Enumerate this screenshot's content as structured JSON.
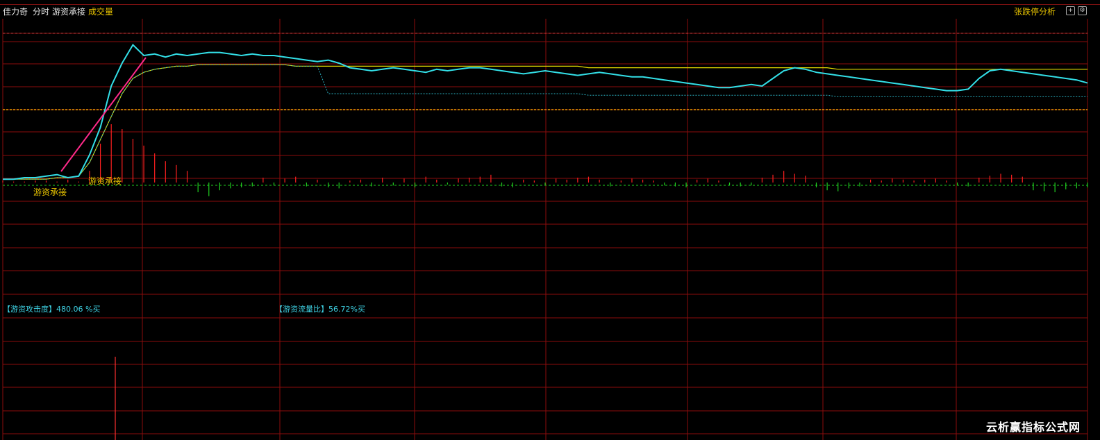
{
  "header": {
    "stock_name": "佳力奇",
    "period": "分时",
    "indicator": "游资承接",
    "volume_label": "成交量",
    "analysis_button": "张跌停分析"
  },
  "annotations": {
    "signal_1": "游资承接",
    "signal_2": "游资承接"
  },
  "indicators": {
    "attack_label": "【游资攻击度】",
    "attack_value": "480.06 %买",
    "flow_label": "【游资流量比】",
    "flow_value": "56.72%买"
  },
  "watermark": "云析赢指标公式网",
  "colors": {
    "grid": "#8b0d0d",
    "price": "#33e0e8",
    "price_up": "#ff2020",
    "avg": "#e8e000",
    "vol_up": "#ff2020",
    "vol_down": "#20d020",
    "label_yellow": "#e6c200",
    "label_cyan": "#3fd4e6"
  },
  "chart_data": {
    "type": "line",
    "note_series": "intraday price (relative, 0=top 100=bottom of price panel)",
    "price": [
      96,
      96,
      95,
      95,
      94,
      93,
      95,
      94,
      80,
      62,
      35,
      20,
      8,
      15,
      14,
      16,
      14,
      15,
      14,
      13,
      13,
      14,
      15,
      14,
      15,
      15,
      16,
      17,
      18,
      19,
      18,
      20,
      23,
      24,
      25,
      24,
      23,
      24,
      25,
      26,
      24,
      25,
      24,
      23,
      23,
      24,
      25,
      26,
      27,
      26,
      25,
      26,
      27,
      28,
      27,
      26,
      27,
      28,
      29,
      29,
      30,
      31,
      32,
      33,
      34,
      35,
      36,
      36,
      35,
      34,
      35,
      30,
      25,
      23,
      24,
      26,
      27,
      28,
      29,
      30,
      31,
      32,
      33,
      34,
      35,
      36,
      37,
      38,
      38,
      37,
      30,
      25,
      24,
      25,
      26,
      27,
      28,
      29,
      30,
      31,
      33
    ],
    "avg": [
      96,
      96,
      96,
      96,
      96,
      95,
      95,
      94,
      85,
      70,
      55,
      40,
      30,
      26,
      24,
      23,
      22,
      22,
      21,
      21,
      21,
      21,
      21,
      21,
      21,
      21,
      21,
      22,
      22,
      22,
      22,
      22,
      22,
      22,
      22,
      22,
      22,
      22,
      22,
      22,
      22,
      22,
      22,
      22,
      22,
      22,
      22,
      22,
      22,
      22,
      22,
      22,
      22,
      22,
      23,
      23,
      23,
      23,
      23,
      23,
      23,
      23,
      23,
      23,
      23,
      23,
      23,
      23,
      23,
      23,
      23,
      23,
      23,
      23,
      23,
      23,
      23,
      24,
      24,
      24,
      24,
      24,
      24,
      24,
      24,
      24,
      24,
      24,
      24,
      24,
      24,
      24,
      24,
      24,
      24,
      24,
      24,
      24,
      24,
      24,
      24
    ],
    "volume": [
      2,
      1,
      1,
      2,
      2,
      1,
      3,
      1,
      12,
      40,
      60,
      55,
      45,
      38,
      30,
      22,
      18,
      12,
      -10,
      -14,
      -8,
      -6,
      -5,
      -4,
      5,
      -3,
      4,
      6,
      -4,
      3,
      -5,
      -6,
      2,
      3,
      -4,
      5,
      -3,
      4,
      -5,
      6,
      3,
      -2,
      4,
      5,
      6,
      8,
      -4,
      -5,
      3,
      2,
      -3,
      4,
      3,
      5,
      6,
      3,
      -4,
      2,
      4,
      3,
      2,
      -3,
      -4,
      -5,
      3,
      4,
      2,
      -3,
      -4,
      -3,
      5,
      8,
      12,
      9,
      7,
      -5,
      -8,
      -9,
      -6,
      -4,
      3,
      2,
      4,
      3,
      2,
      3,
      4,
      2,
      -3,
      -4,
      5,
      7,
      9,
      8,
      6,
      -8,
      -9,
      -10,
      -7,
      -6,
      -5
    ]
  }
}
